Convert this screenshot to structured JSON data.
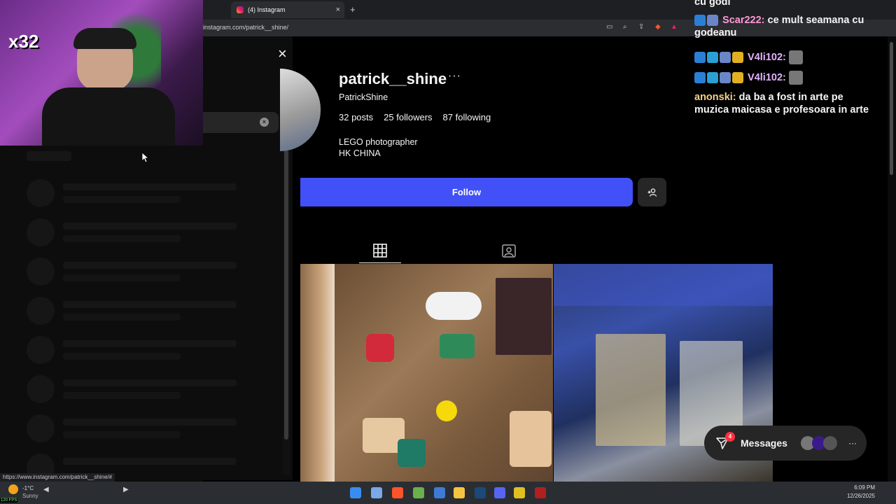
{
  "browser": {
    "tab_title": "(4) Instagram",
    "tab_close": "×",
    "new_tab": "+",
    "url": "instagram.com/patrick__shine/",
    "status_url": "https://www.instagram.com/patrick__shine/#"
  },
  "search_panel": {
    "close": "×",
    "clear": "×"
  },
  "profile": {
    "username": "patrick__shine",
    "more": "···",
    "full_name": "PatrickShine",
    "posts": "32 posts",
    "followers": "25 followers",
    "following": "87 following",
    "bio_line1": "LEGO photographer",
    "bio_line2": "HK CHINA",
    "follow_label": "Follow"
  },
  "messages": {
    "label": "Messages",
    "unread": "4",
    "more": "···"
  },
  "stream_overlay": {
    "counter": "x32",
    "chat": [
      {
        "user": "",
        "text": "cu godi",
        "user_color": "#ffffff"
      },
      {
        "user": "Scar222:",
        "text": "ce mult seamana cu godeanu",
        "user_color": "#ff9ad5"
      },
      {
        "user": "V4li102:",
        "text": "",
        "user_color": "#e3b3ff"
      },
      {
        "user": "V4li102:",
        "text": "",
        "user_color": "#e3b3ff"
      },
      {
        "user": "anonski:",
        "text": "da ba a fost in arte pe muzica maicasa e profesoara in arte",
        "user_color": "#f6d08a"
      }
    ]
  },
  "taskbar": {
    "weather_temp": "-1°C",
    "weather_desc": "Sunny",
    "fps": "120 FPS",
    "time": "6:09 PM",
    "date": "12/26/2025"
  }
}
